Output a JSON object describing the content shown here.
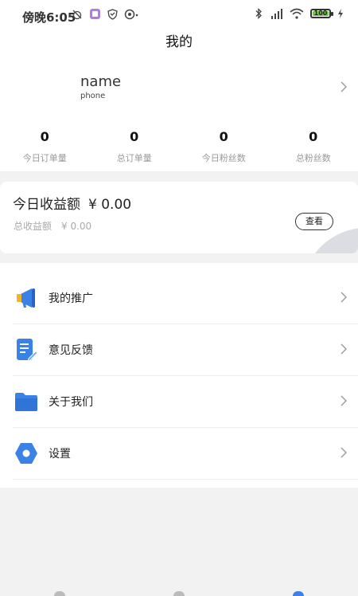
{
  "status_bar": {
    "time": "傍晚6:05",
    "battery": "100"
  },
  "header": {
    "title": "我的"
  },
  "profile": {
    "name": "name",
    "phone": "phone",
    "stats": [
      {
        "value": "0",
        "label": "今日订单量"
      },
      {
        "value": "0",
        "label": "总订单量"
      },
      {
        "value": "0",
        "label": "今日粉丝数"
      },
      {
        "value": "0",
        "label": "总粉丝数"
      }
    ]
  },
  "earnings": {
    "today_label": "今日收益额",
    "today_amount": "¥ 0.00",
    "total_label": "总收益额",
    "total_amount": "¥ 0.00",
    "view_button": "查看"
  },
  "menu": {
    "items": [
      {
        "label": "我的推广",
        "icon": "megaphone-icon"
      },
      {
        "label": "意见反馈",
        "icon": "feedback-document-icon"
      },
      {
        "label": "关于我们",
        "icon": "folder-icon"
      },
      {
        "label": "设置",
        "icon": "settings-hexagon-icon"
      }
    ]
  },
  "colors": {
    "accent_blue": "#3b82e6",
    "battery_green": "#6bcf3a",
    "page_bg": "#f2f2f2"
  }
}
